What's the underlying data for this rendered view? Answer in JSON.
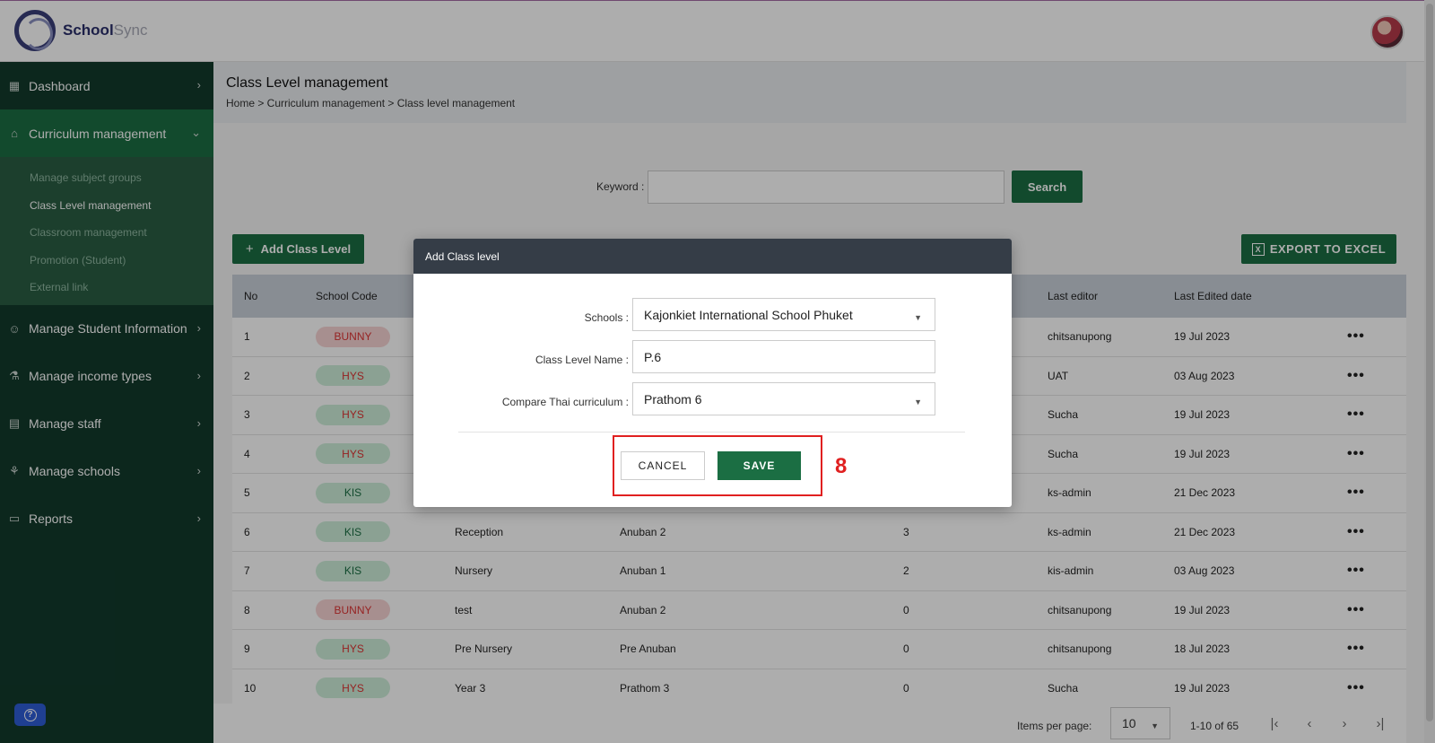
{
  "app": {
    "logo_primary": "School",
    "logo_secondary": "Sync"
  },
  "sidebar": {
    "items": [
      {
        "label": "Dashboard",
        "icon": "grid-icon"
      },
      {
        "label": "Curriculum management",
        "icon": "graduation-cap-icon"
      },
      {
        "label": "Manage Student Information",
        "icon": "student-icon"
      },
      {
        "label": "Manage income types",
        "icon": "income-icon"
      },
      {
        "label": "Manage staff",
        "icon": "staff-icon"
      },
      {
        "label": "Manage schools",
        "icon": "schools-icon"
      },
      {
        "label": "Reports",
        "icon": "clipboard-icon"
      }
    ],
    "submenu": [
      "Manage subject groups",
      "Class Level management",
      "Classroom management",
      "Promotion (Student)",
      "External link"
    ]
  },
  "page": {
    "title": "Class Level management",
    "breadcrumb": "Home > Curriculum management > Class level management"
  },
  "search": {
    "label": "Keyword :",
    "value": "",
    "button": "Search"
  },
  "actions": {
    "add": "Add Class Level",
    "export": "EXPORT TO EXCEL"
  },
  "table": {
    "headers": {
      "no": "No",
      "code": "School Code",
      "editor": "Last editor",
      "date": "Last Edited date"
    },
    "rows": [
      {
        "no": "1",
        "code": "BUNNY",
        "name": "",
        "thai": "",
        "count": "",
        "editor": "chitsanupong",
        "date": "19 Jul 2023"
      },
      {
        "no": "2",
        "code": "HYS",
        "name": "",
        "thai": "",
        "count": "",
        "editor": "UAT",
        "date": "03 Aug 2023"
      },
      {
        "no": "3",
        "code": "HYS",
        "name": "",
        "thai": "",
        "count": "",
        "editor": "Sucha",
        "date": "19 Jul 2023"
      },
      {
        "no": "4",
        "code": "HYS",
        "name": "",
        "thai": "",
        "count": "",
        "editor": "Sucha",
        "date": "19 Jul 2023"
      },
      {
        "no": "5",
        "code": "KIS",
        "name": "",
        "thai": "",
        "count": "",
        "editor": "ks-admin",
        "date": "21 Dec 2023"
      },
      {
        "no": "6",
        "code": "KIS",
        "name": "Reception",
        "thai": "Anuban 2",
        "count": "3",
        "editor": "ks-admin",
        "date": "21 Dec 2023"
      },
      {
        "no": "7",
        "code": "KIS",
        "name": "Nursery",
        "thai": "Anuban 1",
        "count": "2",
        "editor": "kis-admin",
        "date": "03 Aug 2023"
      },
      {
        "no": "8",
        "code": "BUNNY",
        "name": "test",
        "thai": "Anuban 2",
        "count": "0",
        "editor": "chitsanupong",
        "date": "19 Jul 2023"
      },
      {
        "no": "9",
        "code": "HYS",
        "name": "Pre Nursery",
        "thai": "Pre Anuban",
        "count": "0",
        "editor": "chitsanupong",
        "date": "18 Jul 2023"
      },
      {
        "no": "10",
        "code": "HYS",
        "name": "Year 3",
        "thai": "Prathom 3",
        "count": "0",
        "editor": "Sucha",
        "date": "19 Jul 2023"
      }
    ],
    "more": "•••"
  },
  "pagination": {
    "label": "Items per page:",
    "per_page": "10",
    "range": "1-10 of 65"
  },
  "dialog": {
    "title": "Add Class level",
    "schools_label": "Schools :",
    "schools_value": "Kajonkiet International School Phuket",
    "name_label": "Class Level Name :",
    "name_value": "P.6",
    "compare_label": "Compare Thai curriculum :",
    "compare_value": "Prathom 6",
    "cancel": "CANCEL",
    "save": "SAVE",
    "step": "8"
  },
  "colors": {
    "primary": "#1b6e43",
    "sidebar": "#123a2c",
    "header_dark": "#353d47",
    "highlight": "#e02020",
    "badge_red_bg": "#f6d3d3",
    "badge_green_bg": "#cdeed9"
  }
}
